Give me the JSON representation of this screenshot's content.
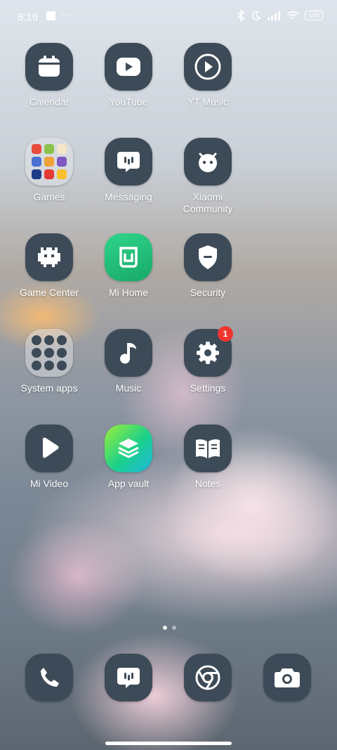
{
  "status_bar": {
    "time": "8:16",
    "more": "···",
    "battery": "100"
  },
  "apps": [
    {
      "label": "Calendar",
      "icon": "calendar-icon"
    },
    {
      "label": "YouTube",
      "icon": "youtube-icon"
    },
    {
      "label": "YT Music",
      "icon": "yt-music-icon"
    },
    {
      "label": "Games",
      "icon": "games-folder-icon"
    },
    {
      "label": "Messaging",
      "icon": "messaging-icon"
    },
    {
      "label": "Xiaomi Community",
      "icon": "xiaomi-community-icon"
    },
    {
      "label": "Game Center",
      "icon": "game-center-icon"
    },
    {
      "label": "Mi Home",
      "icon": "mi-home-icon"
    },
    {
      "label": "Security",
      "icon": "security-icon"
    },
    {
      "label": "System apps",
      "icon": "system-apps-folder-icon"
    },
    {
      "label": "Music",
      "icon": "music-icon"
    },
    {
      "label": "Settings",
      "icon": "settings-icon",
      "badge": "1"
    },
    {
      "label": "Mi Video",
      "icon": "mi-video-icon"
    },
    {
      "label": "App vault",
      "icon": "app-vault-icon"
    },
    {
      "label": "Notes",
      "icon": "notes-icon"
    }
  ],
  "dock": [
    {
      "icon": "phone-icon"
    },
    {
      "icon": "messaging-icon"
    },
    {
      "icon": "chrome-icon"
    },
    {
      "icon": "camera-icon"
    }
  ],
  "colors": {
    "icon_bg": "#3d4a57",
    "badge": "#f0352e",
    "mi_home": "#22c07a",
    "app_vault": "#3ddc84"
  }
}
